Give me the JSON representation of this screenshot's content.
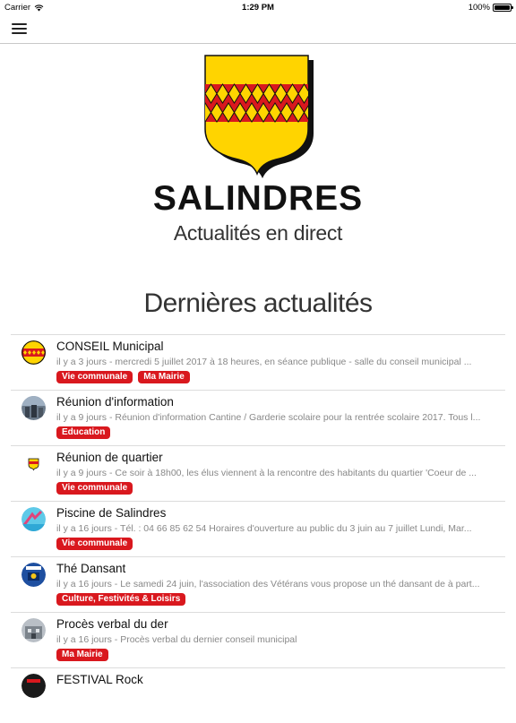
{
  "status_bar": {
    "carrier": "Carrier",
    "time": "1:29 PM",
    "battery": "100%"
  },
  "nav": {
    "menu_icon": "hamburger-menu-icon"
  },
  "colors": {
    "accent_red": "#d9181e",
    "shield_yellow": "#ffd400",
    "shield_red": "#d9181e",
    "shield_black": "#111111"
  },
  "header": {
    "brand": "SALINDRES",
    "tagline": "Actualités en direct"
  },
  "section": {
    "title": "Dernières actualités"
  },
  "news": [
    {
      "title": "CONSEIL Municipal",
      "ago": "il y a 3 jours",
      "excerpt": "mercredi 5 juillet 2017 à 18 heures, en séance publique - salle du conseil municipal  ...",
      "tags": [
        "Vie communale",
        "Ma Mairie"
      ]
    },
    {
      "title": "Réunion d'information",
      "ago": "il y a 9 jours",
      "excerpt": "Réunion d'information Cantine / Garderie scolaire pour la rentrée scolaire 2017. Tous l...",
      "tags": [
        "Education"
      ]
    },
    {
      "title": "Réunion de quartier",
      "ago": "il y a 9 jours",
      "excerpt": "Ce soir à 18h00, les élus viennent à la rencontre des habitants du quartier 'Coeur de ...",
      "tags": [
        "Vie communale"
      ]
    },
    {
      "title": "Piscine de Salindres",
      "ago": "il y a 16 jours",
      "excerpt": "Tél. : 04 66 85 62 54 Horaires d'ouverture au public du 3 juin au 7 juillet Lundi, Mar...",
      "tags": [
        "Vie communale"
      ]
    },
    {
      "title": "Thé Dansant",
      "ago": "il y a 16 jours",
      "excerpt": "Le samedi 24 juin, l'association des Vétérans vous propose un thé dansant de à part...",
      "tags": [
        "Culture, Festivités & Loisirs"
      ]
    },
    {
      "title": "Procès verbal du der",
      "ago": "il y a 16 jours",
      "excerpt": "Procès verbal du dernier conseil municipal",
      "tags": [
        "Ma Mairie"
      ]
    },
    {
      "title": "FESTIVAL Rock",
      "ago": "",
      "excerpt": "",
      "tags": []
    }
  ]
}
